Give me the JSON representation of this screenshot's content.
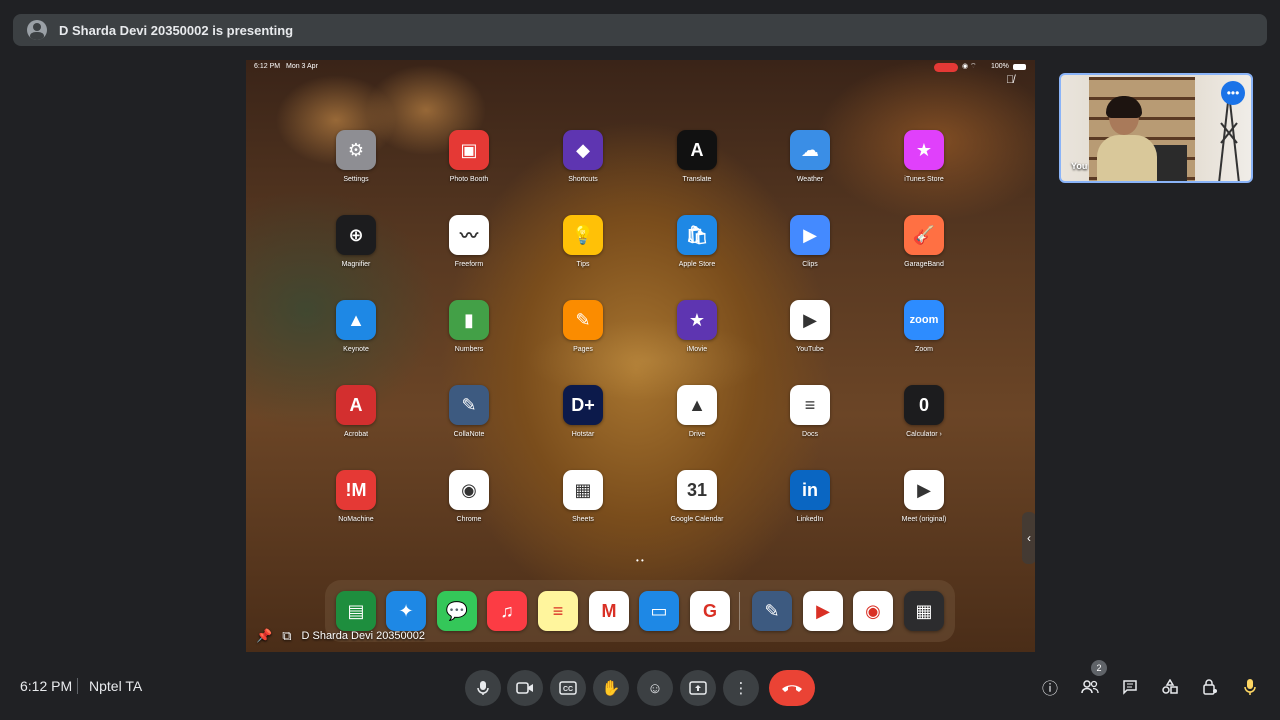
{
  "banner": {
    "text": "D Sharda Devi 20350002 is presenting"
  },
  "ipad": {
    "time": "6:12 PM",
    "date": "Mon 3 Apr",
    "battery": "100%",
    "apps": [
      {
        "label": "Settings",
        "glyph": "⚙",
        "bg": "#8e8e93"
      },
      {
        "label": "Photo Booth",
        "glyph": "▣",
        "bg": "#e53935"
      },
      {
        "label": "Shortcuts",
        "glyph": "◆",
        "bg": "#5e35b1"
      },
      {
        "label": "Translate",
        "glyph": "A",
        "bg": "#111111"
      },
      {
        "label": "Weather",
        "glyph": "☁",
        "bg": "#3a8ee6"
      },
      {
        "label": "iTunes Store",
        "glyph": "★",
        "bg": "#e040fb"
      },
      {
        "label": "Magnifier",
        "glyph": "⊕",
        "bg": "#1c1c1e"
      },
      {
        "label": "Freeform",
        "glyph": "〰",
        "bg": "#ffffff"
      },
      {
        "label": "Tips",
        "glyph": "💡",
        "bg": "#ffc107"
      },
      {
        "label": "Apple Store",
        "glyph": "🛍",
        "bg": "#1e88e5"
      },
      {
        "label": "Clips",
        "glyph": "▶",
        "bg": "#448aff"
      },
      {
        "label": "GarageBand",
        "glyph": "🎸",
        "bg": "#ff7043"
      },
      {
        "label": "Keynote",
        "glyph": "▲",
        "bg": "#1e88e5"
      },
      {
        "label": "Numbers",
        "glyph": "▮",
        "bg": "#43a047"
      },
      {
        "label": "Pages",
        "glyph": "✎",
        "bg": "#fb8c00"
      },
      {
        "label": "iMovie",
        "glyph": "★",
        "bg": "#5e35b1"
      },
      {
        "label": "YouTube",
        "glyph": "▶",
        "bg": "#ffffff"
      },
      {
        "label": "Zoom",
        "glyph": "zoom",
        "bg": "#2d8cff"
      },
      {
        "label": "Acrobat",
        "glyph": "A",
        "bg": "#d32f2f"
      },
      {
        "label": "CollaNote",
        "glyph": "✎",
        "bg": "#3d5a80"
      },
      {
        "label": "Hotstar",
        "glyph": "D+",
        "bg": "#0c1a4b"
      },
      {
        "label": "Drive",
        "glyph": "▲",
        "bg": "#ffffff"
      },
      {
        "label": "Docs",
        "glyph": "≡",
        "bg": "#ffffff"
      },
      {
        "label": "Calculator ›",
        "glyph": "0",
        "bg": "#1c1c1e"
      },
      {
        "label": "NoMachine",
        "glyph": "!M",
        "bg": "#e53935"
      },
      {
        "label": "Chrome",
        "glyph": "◉",
        "bg": "#ffffff"
      },
      {
        "label": "Sheets",
        "glyph": "▦",
        "bg": "#ffffff"
      },
      {
        "label": "Google Calendar",
        "glyph": "31",
        "bg": "#ffffff"
      },
      {
        "label": "LinkedIn",
        "glyph": "in",
        "bg": "#0a66c2"
      },
      {
        "label": "Meet (original)",
        "glyph": "▶",
        "bg": "#ffffff"
      }
    ],
    "dock": [
      {
        "name": "classroom",
        "glyph": "▤",
        "bg": "#1e8e3e"
      },
      {
        "name": "safari",
        "glyph": "✦",
        "bg": "#1e88e5"
      },
      {
        "name": "messages",
        "glyph": "💬",
        "bg": "#34c759"
      },
      {
        "name": "music",
        "glyph": "♫",
        "bg": "#fc3c44"
      },
      {
        "name": "notes",
        "glyph": "≡",
        "bg": "#fff59d"
      },
      {
        "name": "gmail",
        "glyph": "M",
        "bg": "#ffffff"
      },
      {
        "name": "files",
        "glyph": "▭",
        "bg": "#1e88e5"
      },
      {
        "name": "google",
        "glyph": "G",
        "bg": "#ffffff"
      },
      {
        "name": "collanote",
        "glyph": "✎",
        "bg": "#3d5a80"
      },
      {
        "name": "meet",
        "glyph": "▶",
        "bg": "#ffffff"
      },
      {
        "name": "chrome",
        "glyph": "◉",
        "bg": "#ffffff"
      },
      {
        "name": "app-library",
        "glyph": "▦",
        "bg": "#2c2c2e"
      }
    ],
    "presenter_name": "D Sharda Devi 20350002"
  },
  "self_tile": {
    "label": "You"
  },
  "bottom_bar": {
    "time": "6:12 PM",
    "meeting_name": "Nptel TA",
    "people_count": "2"
  }
}
